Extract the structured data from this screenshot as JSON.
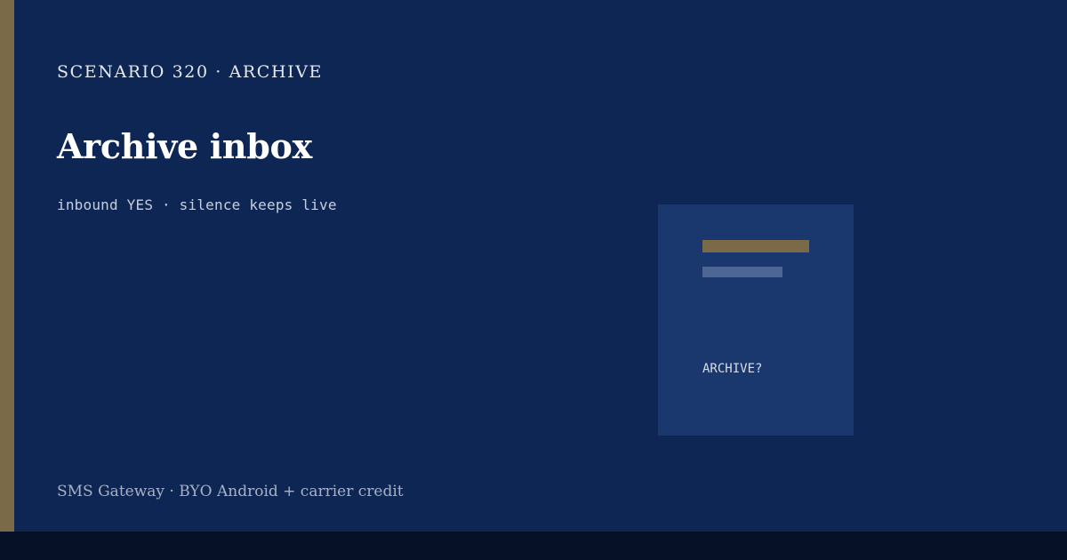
{
  "header": {
    "eyebrow": "SCENARIO 320 · ARCHIVE",
    "title": "Archive inbox",
    "subtitle": "inbound YES · silence keeps live"
  },
  "card": {
    "prompt": "ARCHIVE?"
  },
  "footer": {
    "text": "SMS Gateway · BYO Android + carrier credit"
  },
  "colors": {
    "background": "#0d2654",
    "accent": "#7a6a48",
    "card": "#1a386d",
    "bottom_band": "#061026"
  }
}
